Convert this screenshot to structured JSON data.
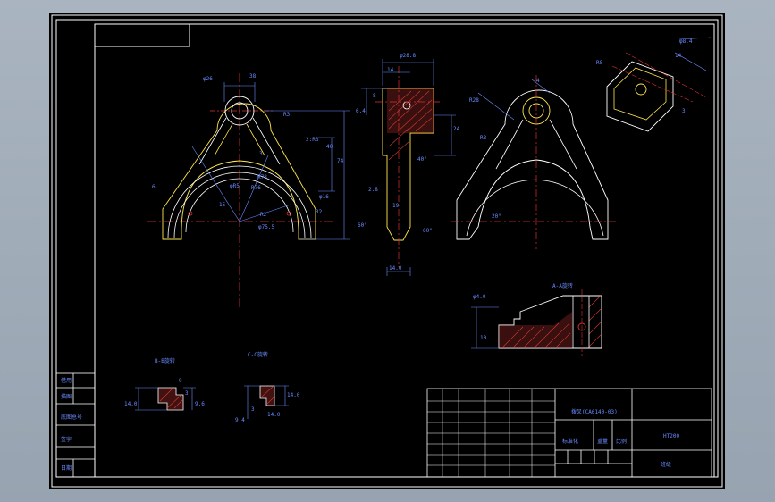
{
  "views": {
    "section_bb": "B-B旋转",
    "section_cc": "C-C旋转",
    "section_aa": "A-A旋转"
  },
  "dimensions": {
    "front": [
      "φ26",
      "38",
      "R3",
      "2:R3",
      "40",
      "74",
      "R78",
      "R76",
      "φ16",
      "φR5",
      "R2",
      "φ75.5",
      "6",
      "15",
      "3",
      "R2"
    ],
    "side": [
      "φ28.8",
      "14",
      "8",
      "24",
      "2.8",
      "40°",
      "60°",
      "60°",
      "14.0",
      "19",
      "6.4"
    ],
    "right": [
      "R28",
      "4",
      "20°",
      "R3"
    ],
    "iso": [
      "R8",
      "φ8.4",
      "14",
      "3"
    ],
    "aa": [
      "φ4.0",
      "10"
    ],
    "bb": [
      "9",
      "3",
      "14.0",
      "9.6"
    ],
    "cc": [
      "14.0",
      "3",
      "9.4",
      "14.0"
    ]
  },
  "left_strip": [
    "借用",
    "描图",
    "底图总号",
    "签字",
    "日期"
  ],
  "title_block": {
    "part_name": "拨叉(CA6140-03)",
    "material": "HT200",
    "company": "班级",
    "sheet_label": "标准化",
    "scale_labels": [
      "重量",
      "比例"
    ]
  },
  "colors": {
    "outline": "#ffffff",
    "dimension": "#6a8cff",
    "centerline": "#e03030",
    "hatch": "#d23c2c",
    "part_yellow": "#ffe64d"
  }
}
